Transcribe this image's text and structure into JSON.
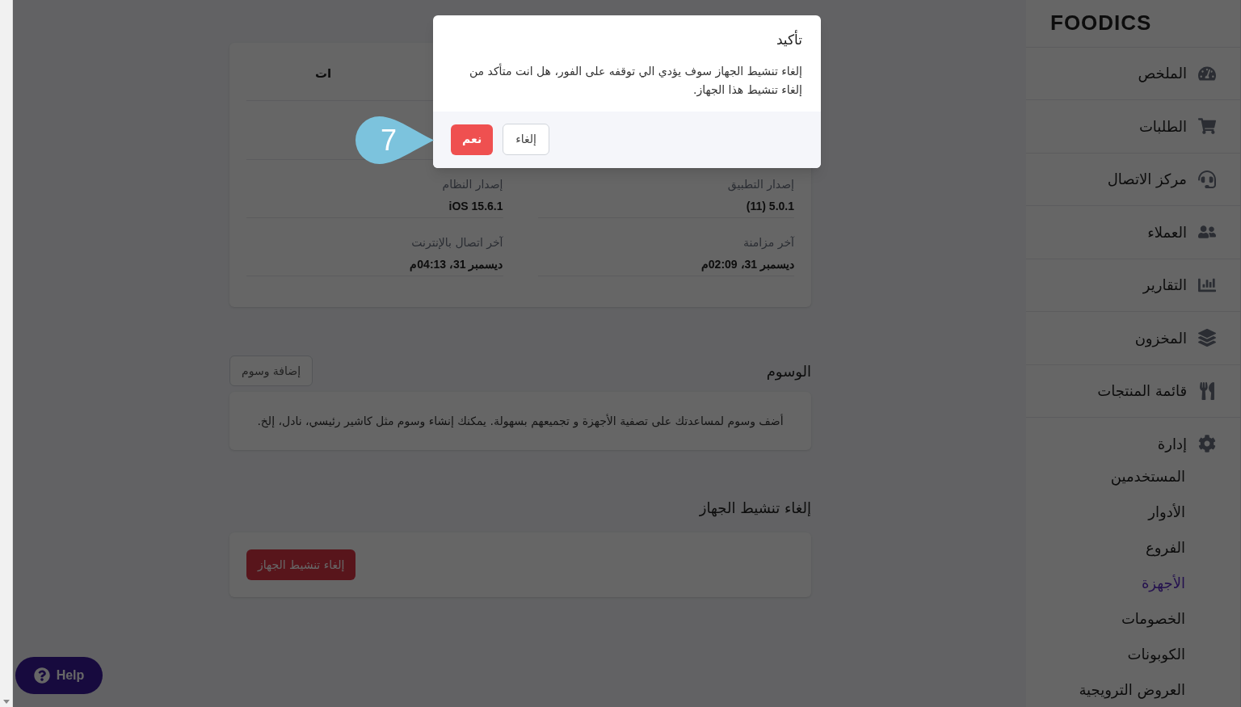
{
  "sidebar": {
    "logo": "FOODICS",
    "items": [
      {
        "label": "الملخص"
      },
      {
        "label": "الطلبات"
      },
      {
        "label": "مركز الاتصال"
      },
      {
        "label": "العملاء"
      },
      {
        "label": "التقارير"
      },
      {
        "label": "المخزون"
      },
      {
        "label": "قائمة المنتجات"
      },
      {
        "label": "إدارة",
        "children": [
          {
            "label": "المستخدمين",
            "selected": false
          },
          {
            "label": "الأدوار",
            "selected": false
          },
          {
            "label": "الفروع",
            "selected": false
          },
          {
            "label": "الأجهزة",
            "selected": true
          },
          {
            "label": "الخصومات",
            "selected": false
          },
          {
            "label": "الكوبونات",
            "selected": false
          },
          {
            "label": "العروض الترويجية",
            "selected": false
          }
        ]
      }
    ]
  },
  "device_card": {
    "title_fragment": "ات",
    "fields": [
      {
        "label": "إصدار التطبيق",
        "value": "5.0.1 (11)"
      },
      {
        "label": "إصدار النظام",
        "value": "iOS 15.6.1"
      },
      {
        "label": "آخر مزامنة",
        "value": "ديسمبر 31، 02:09م"
      },
      {
        "label": "آخر اتصال بالإنترنت",
        "value": "ديسمبر 31، 04:13م"
      }
    ]
  },
  "tags": {
    "title": "الوسوم",
    "add_button": "إضافة وسوم",
    "empty_text": "أضف وسوم لمساعدتك على تصفية الأجهزة و تجميعهم بسهولة. يمكنك إنشاء وسوم مثل كاشير رئيسي، نادل، إلخ."
  },
  "deactivate": {
    "title": "إلغاء تنشيط الجهاز",
    "button": "إلغاء تنشيط الجهاز"
  },
  "help_button": "Help",
  "dialog": {
    "title": "تأكيد",
    "message": "إلغاء تنشيط الجهاز سوف يؤدي الي توقفه على الفور، هل انت متأكد من إلغاء تنشيط هذا الجهاز.",
    "cancel": "إلغاء",
    "confirm": "نعم"
  },
  "callout": "7"
}
